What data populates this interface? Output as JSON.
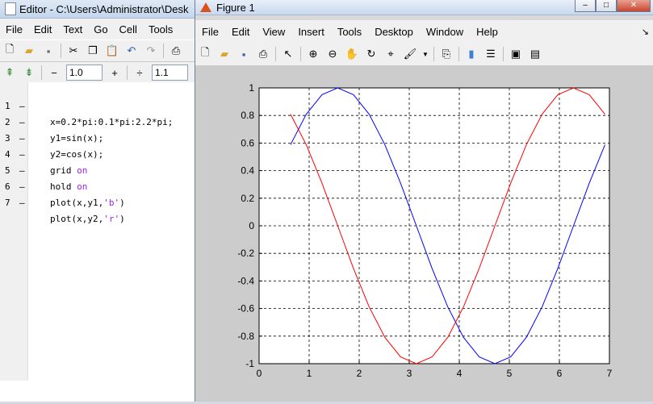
{
  "editor": {
    "title": "Editor - C:\\Users\\Administrator\\Desk",
    "menus": [
      "File",
      "Edit",
      "Text",
      "Go",
      "Cell",
      "Tools"
    ],
    "cell_decrement": "−",
    "cell_value1": "1.0",
    "cell_increment": "+",
    "cell_divide": "÷",
    "cell_value2": "1.1",
    "lines": [
      {
        "num": "1",
        "code": "x=0.2*pi:0.1*pi:2.2*pi;"
      },
      {
        "num": "2",
        "code": "y1=sin(x);"
      },
      {
        "num": "3",
        "code": "y2=cos(x);"
      },
      {
        "num": "4",
        "code": "grid ",
        "kw": "on"
      },
      {
        "num": "5",
        "code": "hold ",
        "kw": "on"
      },
      {
        "num": "6",
        "code": "plot(x,y1,",
        "str": "'b'",
        "tail": ")"
      },
      {
        "num": "7",
        "code": "plot(x,y2,",
        "str": "'r'",
        "tail": ")"
      }
    ]
  },
  "figure": {
    "title": "Figure 1",
    "menus": [
      "File",
      "Edit",
      "View",
      "Insert",
      "Tools",
      "Desktop",
      "Window",
      "Help"
    ]
  },
  "chart_data": {
    "type": "line",
    "title": "",
    "xlabel": "",
    "ylabel": "",
    "xlim": [
      0,
      7
    ],
    "ylim": [
      -1,
      1
    ],
    "xticks": [
      "0",
      "1",
      "2",
      "3",
      "4",
      "5",
      "6",
      "7"
    ],
    "yticks": [
      "1",
      "0.8",
      "0.6",
      "0.4",
      "0.2",
      "0",
      "-0.2",
      "-0.4",
      "-0.6",
      "-0.8",
      "-1"
    ],
    "grid": true,
    "x": [
      0.628,
      0.942,
      1.257,
      1.571,
      1.885,
      2.199,
      2.513,
      2.827,
      3.142,
      3.456,
      3.77,
      4.084,
      4.398,
      4.712,
      5.027,
      5.341,
      5.655,
      5.969,
      6.283,
      6.597,
      6.912
    ],
    "series": [
      {
        "color": "#0000ff",
        "values": [
          0.588,
          0.809,
          0.951,
          1.0,
          0.951,
          0.809,
          0.588,
          0.309,
          0.0,
          -0.309,
          -0.588,
          -0.809,
          -0.951,
          -1.0,
          -0.951,
          -0.809,
          -0.588,
          -0.309,
          0.0,
          0.309,
          0.588
        ]
      },
      {
        "color": "#ff0000",
        "values": [
          0.809,
          0.588,
          0.309,
          0.0,
          -0.309,
          -0.588,
          -0.809,
          -0.951,
          -1.0,
          -0.951,
          -0.809,
          -0.588,
          -0.309,
          0.0,
          0.309,
          0.588,
          0.809,
          0.951,
          1.0,
          0.951,
          0.809
        ]
      }
    ]
  }
}
